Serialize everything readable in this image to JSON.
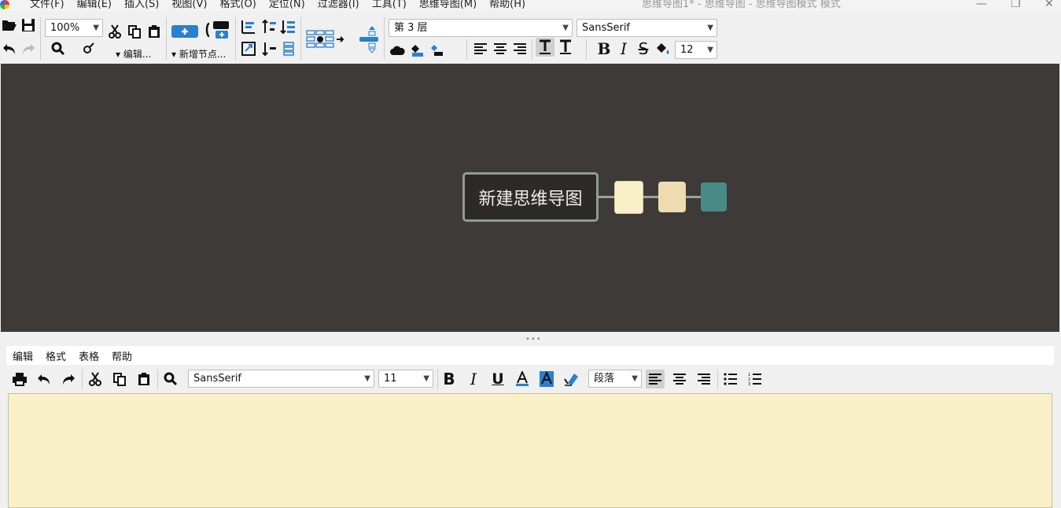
{
  "window": {
    "title": "思维导图1* - 思维导图 - 思维导图模式 模式",
    "menu": [
      "文件(F)",
      "编辑(E)",
      "插入(S)",
      "视图(V)",
      "格式(O)",
      "定位(N)",
      "过滤器(I)",
      "工具(T)",
      "思维导图(M)",
      "帮助(H)"
    ]
  },
  "toolbar": {
    "zoom": "100%",
    "edit_label": "▾ 编辑...",
    "add_node_label": "▾ 新增节点...",
    "level_select": "第 3 层",
    "font_family": "SansSerif",
    "font_size": "12"
  },
  "mindmap": {
    "root_text": "新建思维导图",
    "colors": {
      "canvas": "#3e3a37",
      "child1": "#f9f0c8",
      "child2": "#ecdcb0",
      "child3": "#4a8a86"
    }
  },
  "editor": {
    "menu": [
      "编辑",
      "格式",
      "表格",
      "帮助"
    ],
    "font_family": "SansSerif",
    "font_size": "11",
    "paragraph_style": "段落",
    "background": "#faf0c8"
  }
}
